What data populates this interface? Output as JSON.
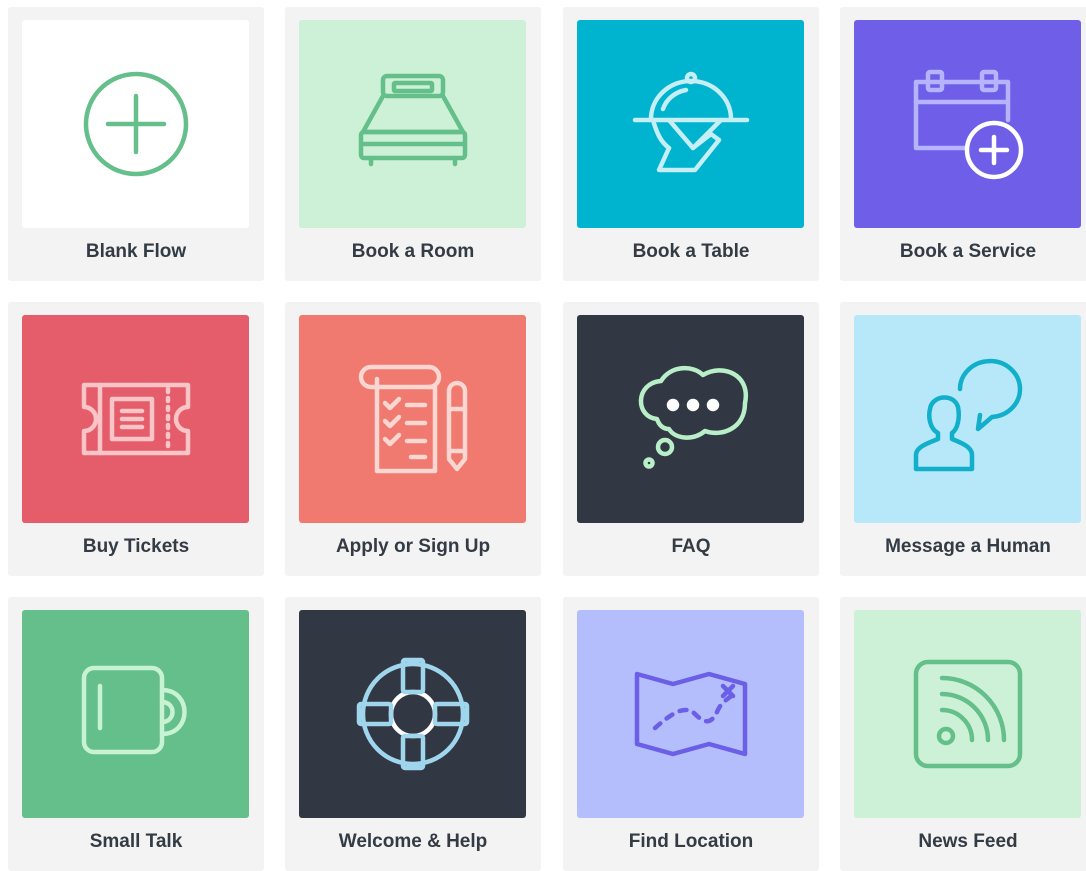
{
  "cards": [
    {
      "label": "Blank Flow",
      "icon": "plus-circle-icon",
      "bg": "#ffffff",
      "stroke": "#65bf8a"
    },
    {
      "label": "Book a Room",
      "icon": "bed-icon",
      "bg": "#ccf1d7",
      "stroke": "#65bf8a"
    },
    {
      "label": "Book a Table",
      "icon": "serving-dish-icon",
      "bg": "#00b3cf",
      "stroke": "#c6eef5"
    },
    {
      "label": "Book a Service",
      "icon": "calendar-add-icon",
      "bg": "#6e5ee8",
      "stroke": "#b7b3ff"
    },
    {
      "label": "Buy Tickets",
      "icon": "ticket-icon",
      "bg": "#e55d6a",
      "stroke": "#fbc4c6"
    },
    {
      "label": "Apply or Sign Up",
      "icon": "checklist-pen-icon",
      "bg": "#f07a70",
      "stroke": "#fcd6d0"
    },
    {
      "label": "FAQ",
      "icon": "thought-bubble-icon",
      "bg": "#323843",
      "stroke": "#b8efc9"
    },
    {
      "label": "Message a Human",
      "icon": "person-speech-icon",
      "bg": "#b7e8f9",
      "stroke": "#12afca"
    },
    {
      "label": "Small Talk",
      "icon": "coffee-mug-icon",
      "bg": "#65bf8a",
      "stroke": "#c8f2d4"
    },
    {
      "label": "Welcome & Help",
      "icon": "lifebuoy-icon",
      "bg": "#323843",
      "stroke": "#9fd6ee"
    },
    {
      "label": "Find Location",
      "icon": "treasure-map-icon",
      "bg": "#b5befc",
      "stroke": "#6a5fe6"
    },
    {
      "label": "News Feed",
      "icon": "rss-feed-icon",
      "bg": "#ccf1d7",
      "stroke": "#65bf8a"
    }
  ]
}
